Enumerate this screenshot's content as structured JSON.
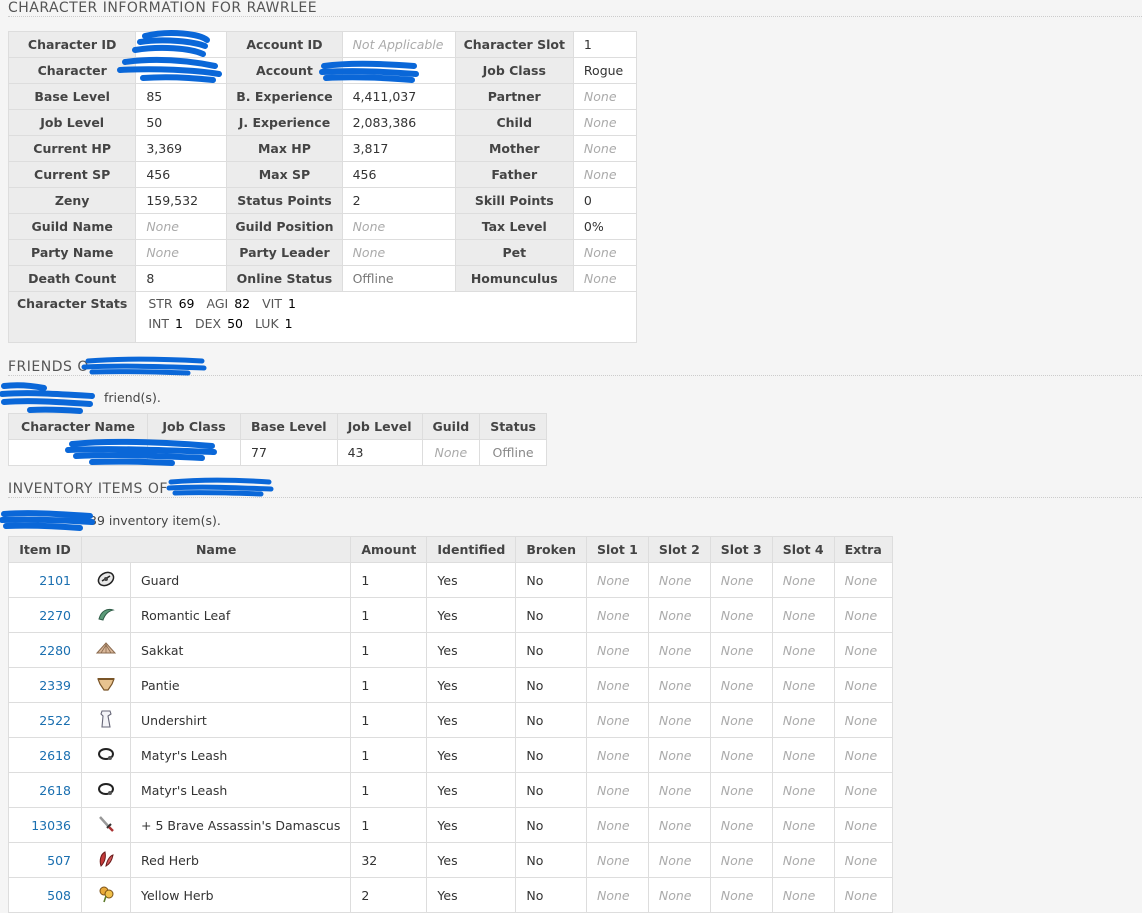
{
  "character_section": {
    "heading": "CHARACTER INFORMATION FOR RAWRLEE",
    "rows": [
      [
        {
          "h": "Character ID"
        },
        {
          "v": "",
          "redacted": true
        },
        {
          "h": "Account ID"
        },
        {
          "v": "Not Applicable",
          "none": true
        },
        {
          "h": "Character Slot"
        },
        {
          "v": "1"
        }
      ],
      [
        {
          "h": "Character"
        },
        {
          "v": "",
          "redacted": true
        },
        {
          "h": "Account"
        },
        {
          "v": "",
          "redacted": true
        },
        {
          "h": "Job Class"
        },
        {
          "v": "Rogue"
        }
      ],
      [
        {
          "h": "Base Level"
        },
        {
          "v": "85"
        },
        {
          "h": "B. Experience"
        },
        {
          "v": "4,411,037"
        },
        {
          "h": "Partner"
        },
        {
          "v": "None",
          "none": true
        }
      ],
      [
        {
          "h": "Job Level"
        },
        {
          "v": "50"
        },
        {
          "h": "J. Experience"
        },
        {
          "v": "2,083,386"
        },
        {
          "h": "Child"
        },
        {
          "v": "None",
          "none": true
        }
      ],
      [
        {
          "h": "Current HP"
        },
        {
          "v": "3,369"
        },
        {
          "h": "Max HP"
        },
        {
          "v": "3,817"
        },
        {
          "h": "Mother"
        },
        {
          "v": "None",
          "none": true
        }
      ],
      [
        {
          "h": "Current SP"
        },
        {
          "v": "456"
        },
        {
          "h": "Max SP"
        },
        {
          "v": "456"
        },
        {
          "h": "Father"
        },
        {
          "v": "None",
          "none": true
        }
      ],
      [
        {
          "h": "Zeny"
        },
        {
          "v": "159,532"
        },
        {
          "h": "Status Points"
        },
        {
          "v": "2"
        },
        {
          "h": "Skill Points"
        },
        {
          "v": "0"
        }
      ],
      [
        {
          "h": "Guild Name"
        },
        {
          "v": "None",
          "none": true
        },
        {
          "h": "Guild Position"
        },
        {
          "v": "None",
          "none": true
        },
        {
          "h": "Tax Level"
        },
        {
          "v": "0%"
        }
      ],
      [
        {
          "h": "Party Name"
        },
        {
          "v": "None",
          "none": true
        },
        {
          "h": "Party Leader"
        },
        {
          "v": "None",
          "none": true
        },
        {
          "h": "Pet"
        },
        {
          "v": "None",
          "none": true
        }
      ],
      [
        {
          "h": "Death Count"
        },
        {
          "v": "8"
        },
        {
          "h": "Online Status"
        },
        {
          "v": "Offline",
          "grey": true
        },
        {
          "h": "Homunculus"
        },
        {
          "v": "None",
          "none": true
        }
      ]
    ],
    "stats_label": "Character Stats",
    "stats": [
      [
        {
          "k": "STR",
          "v": "69"
        },
        {
          "k": "AGI",
          "v": "82"
        },
        {
          "k": "VIT",
          "v": "1"
        }
      ],
      [
        {
          "k": "INT",
          "v": "1"
        },
        {
          "k": "DEX",
          "v": "50"
        },
        {
          "k": "LUK",
          "v": "1"
        }
      ]
    ]
  },
  "friends_section": {
    "heading": "FRIENDS O",
    "note": "friend(s).",
    "columns": [
      "Character Name",
      "Job Class",
      "Base Level",
      "Job Level",
      "Guild",
      "Status"
    ],
    "rows": [
      {
        "name": "",
        "job": "",
        "base": "77",
        "joblvl": "43",
        "guild": "None",
        "status": "Offline"
      }
    ]
  },
  "inventory_section": {
    "heading": "INVENTORY ITEMS OF",
    "note": "39 inventory item(s).",
    "columns": [
      "Item ID",
      "Name",
      "Amount",
      "Identified",
      "Broken",
      "Slot 1",
      "Slot 2",
      "Slot 3",
      "Slot 4",
      "Extra"
    ],
    "none_label": "None",
    "items": [
      {
        "id": "2101",
        "icon": "guard-shield-icon",
        "name": "Guard",
        "amount": "1",
        "identified": "Yes",
        "broken": "No"
      },
      {
        "id": "2270",
        "icon": "romantic-leaf-icon",
        "name": "Romantic Leaf",
        "amount": "1",
        "identified": "Yes",
        "broken": "No"
      },
      {
        "id": "2280",
        "icon": "sakkat-hat-icon",
        "name": "Sakkat",
        "amount": "1",
        "identified": "Yes",
        "broken": "No"
      },
      {
        "id": "2339",
        "icon": "pantie-icon",
        "name": "Pantie",
        "amount": "1",
        "identified": "Yes",
        "broken": "No"
      },
      {
        "id": "2522",
        "icon": "undershirt-icon",
        "name": "Undershirt",
        "amount": "1",
        "identified": "Yes",
        "broken": "No"
      },
      {
        "id": "2618",
        "icon": "leash-icon",
        "name": "Matyr's Leash",
        "amount": "1",
        "identified": "Yes",
        "broken": "No"
      },
      {
        "id": "2618",
        "icon": "leash-icon",
        "name": "Matyr's Leash",
        "amount": "1",
        "identified": "Yes",
        "broken": "No"
      },
      {
        "id": "13036",
        "icon": "damascus-dagger-icon",
        "name": "+ 5 Brave Assassin's Damascus",
        "amount": "1",
        "identified": "Yes",
        "broken": "No"
      },
      {
        "id": "507",
        "icon": "red-herb-icon",
        "name": "Red Herb",
        "amount": "32",
        "identified": "Yes",
        "broken": "No"
      },
      {
        "id": "508",
        "icon": "yellow-herb-icon",
        "name": "Yellow Herb",
        "amount": "2",
        "identified": "Yes",
        "broken": "No"
      }
    ]
  },
  "colors": {
    "link": "#1a6fb0",
    "redaction": "#0a67d8",
    "header_bg": "#ececec"
  }
}
